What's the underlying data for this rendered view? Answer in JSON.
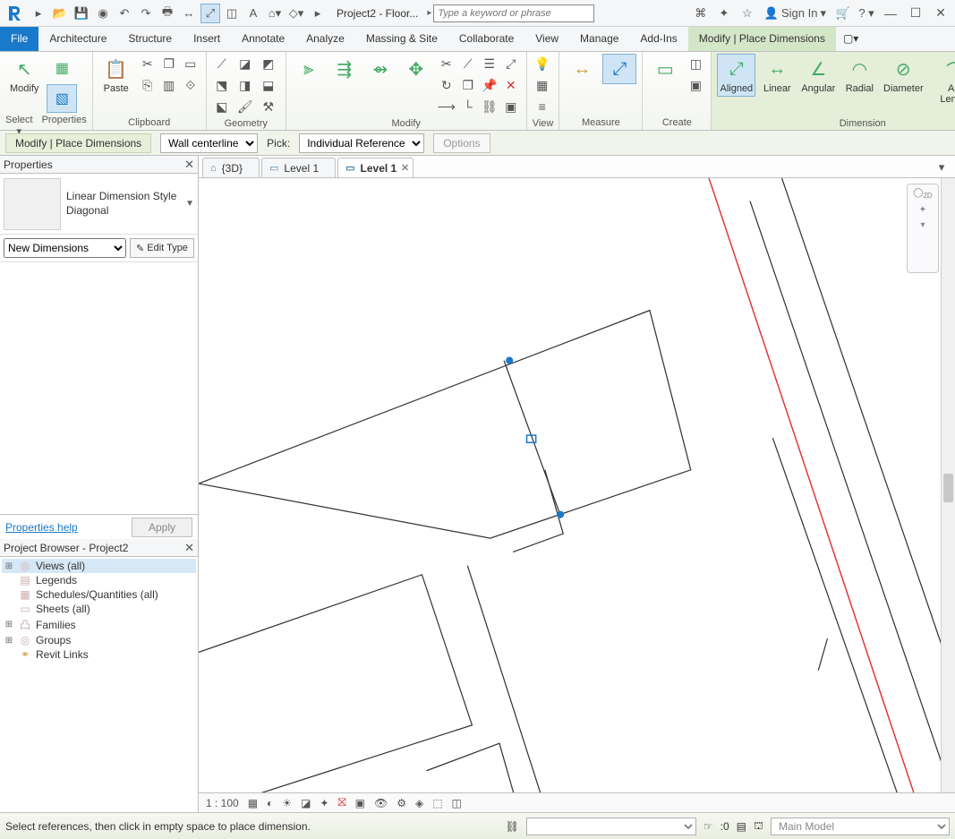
{
  "title": "Project2 - Floor...",
  "search_placeholder": "Type a keyword or phrase",
  "signin": "Sign In",
  "menu_tabs": [
    "File",
    "Architecture",
    "Structure",
    "Insert",
    "Annotate",
    "Analyze",
    "Massing & Site",
    "Collaborate",
    "View",
    "Manage",
    "Add-Ins",
    "Modify | Place Dimensions"
  ],
  "menu_active": 11,
  "ribbon_groups": {
    "modify": {
      "label": "Modify",
      "select": "Select ▾",
      "props": "Properties"
    },
    "clipboard": {
      "label": "Clipboard",
      "paste": "Paste"
    },
    "geometry": {
      "label": "Geometry"
    },
    "modify2": {
      "label": "Modify"
    },
    "view": {
      "label": "View"
    },
    "measure": {
      "label": "Measure"
    },
    "create": {
      "label": "Create"
    },
    "dimension": {
      "label": "Dimension",
      "items": [
        "Aligned",
        "Linear",
        "Angular",
        "Radial",
        "Diameter",
        "Arc Length"
      ]
    }
  },
  "optbar": {
    "mode": "Modify | Place Dimensions",
    "place_combo": "Wall centerline",
    "pick_label": "Pick:",
    "pick_combo": "Individual Reference",
    "options_btn": "Options"
  },
  "properties": {
    "title": "Properties",
    "type_line1": "Linear Dimension Style",
    "type_line2": "Diagonal",
    "instance_combo": "New Dimensions",
    "edit_type": "Edit Type",
    "help": "Properties help",
    "apply": "Apply"
  },
  "browser": {
    "title": "Project Browser - Project2",
    "items": [
      {
        "exp": "⊞",
        "icon": "◎",
        "label": "Views (all)",
        "sel": true
      },
      {
        "exp": "",
        "icon": "▤",
        "label": "Legends"
      },
      {
        "exp": "",
        "icon": "▦",
        "label": "Schedules/Quantities (all)"
      },
      {
        "exp": "",
        "icon": "▭",
        "label": "Sheets (all)"
      },
      {
        "exp": "⊞",
        "icon": "凸",
        "label": "Families"
      },
      {
        "exp": "⊞",
        "icon": "◎",
        "label": "Groups"
      },
      {
        "exp": "",
        "icon": "⚭",
        "label": "Revit Links"
      }
    ]
  },
  "view_tabs": [
    {
      "icon": "⌂",
      "label": "{3D}"
    },
    {
      "icon": "▭",
      "label": "Level 1"
    },
    {
      "icon": "▭",
      "label": "Level 1",
      "active": true
    }
  ],
  "viewbar": {
    "scale": "1 : 100"
  },
  "status": {
    "hint": "Select references, then click in empty space to place dimension.",
    "sel_count": ":0",
    "workset": "Main Model"
  }
}
